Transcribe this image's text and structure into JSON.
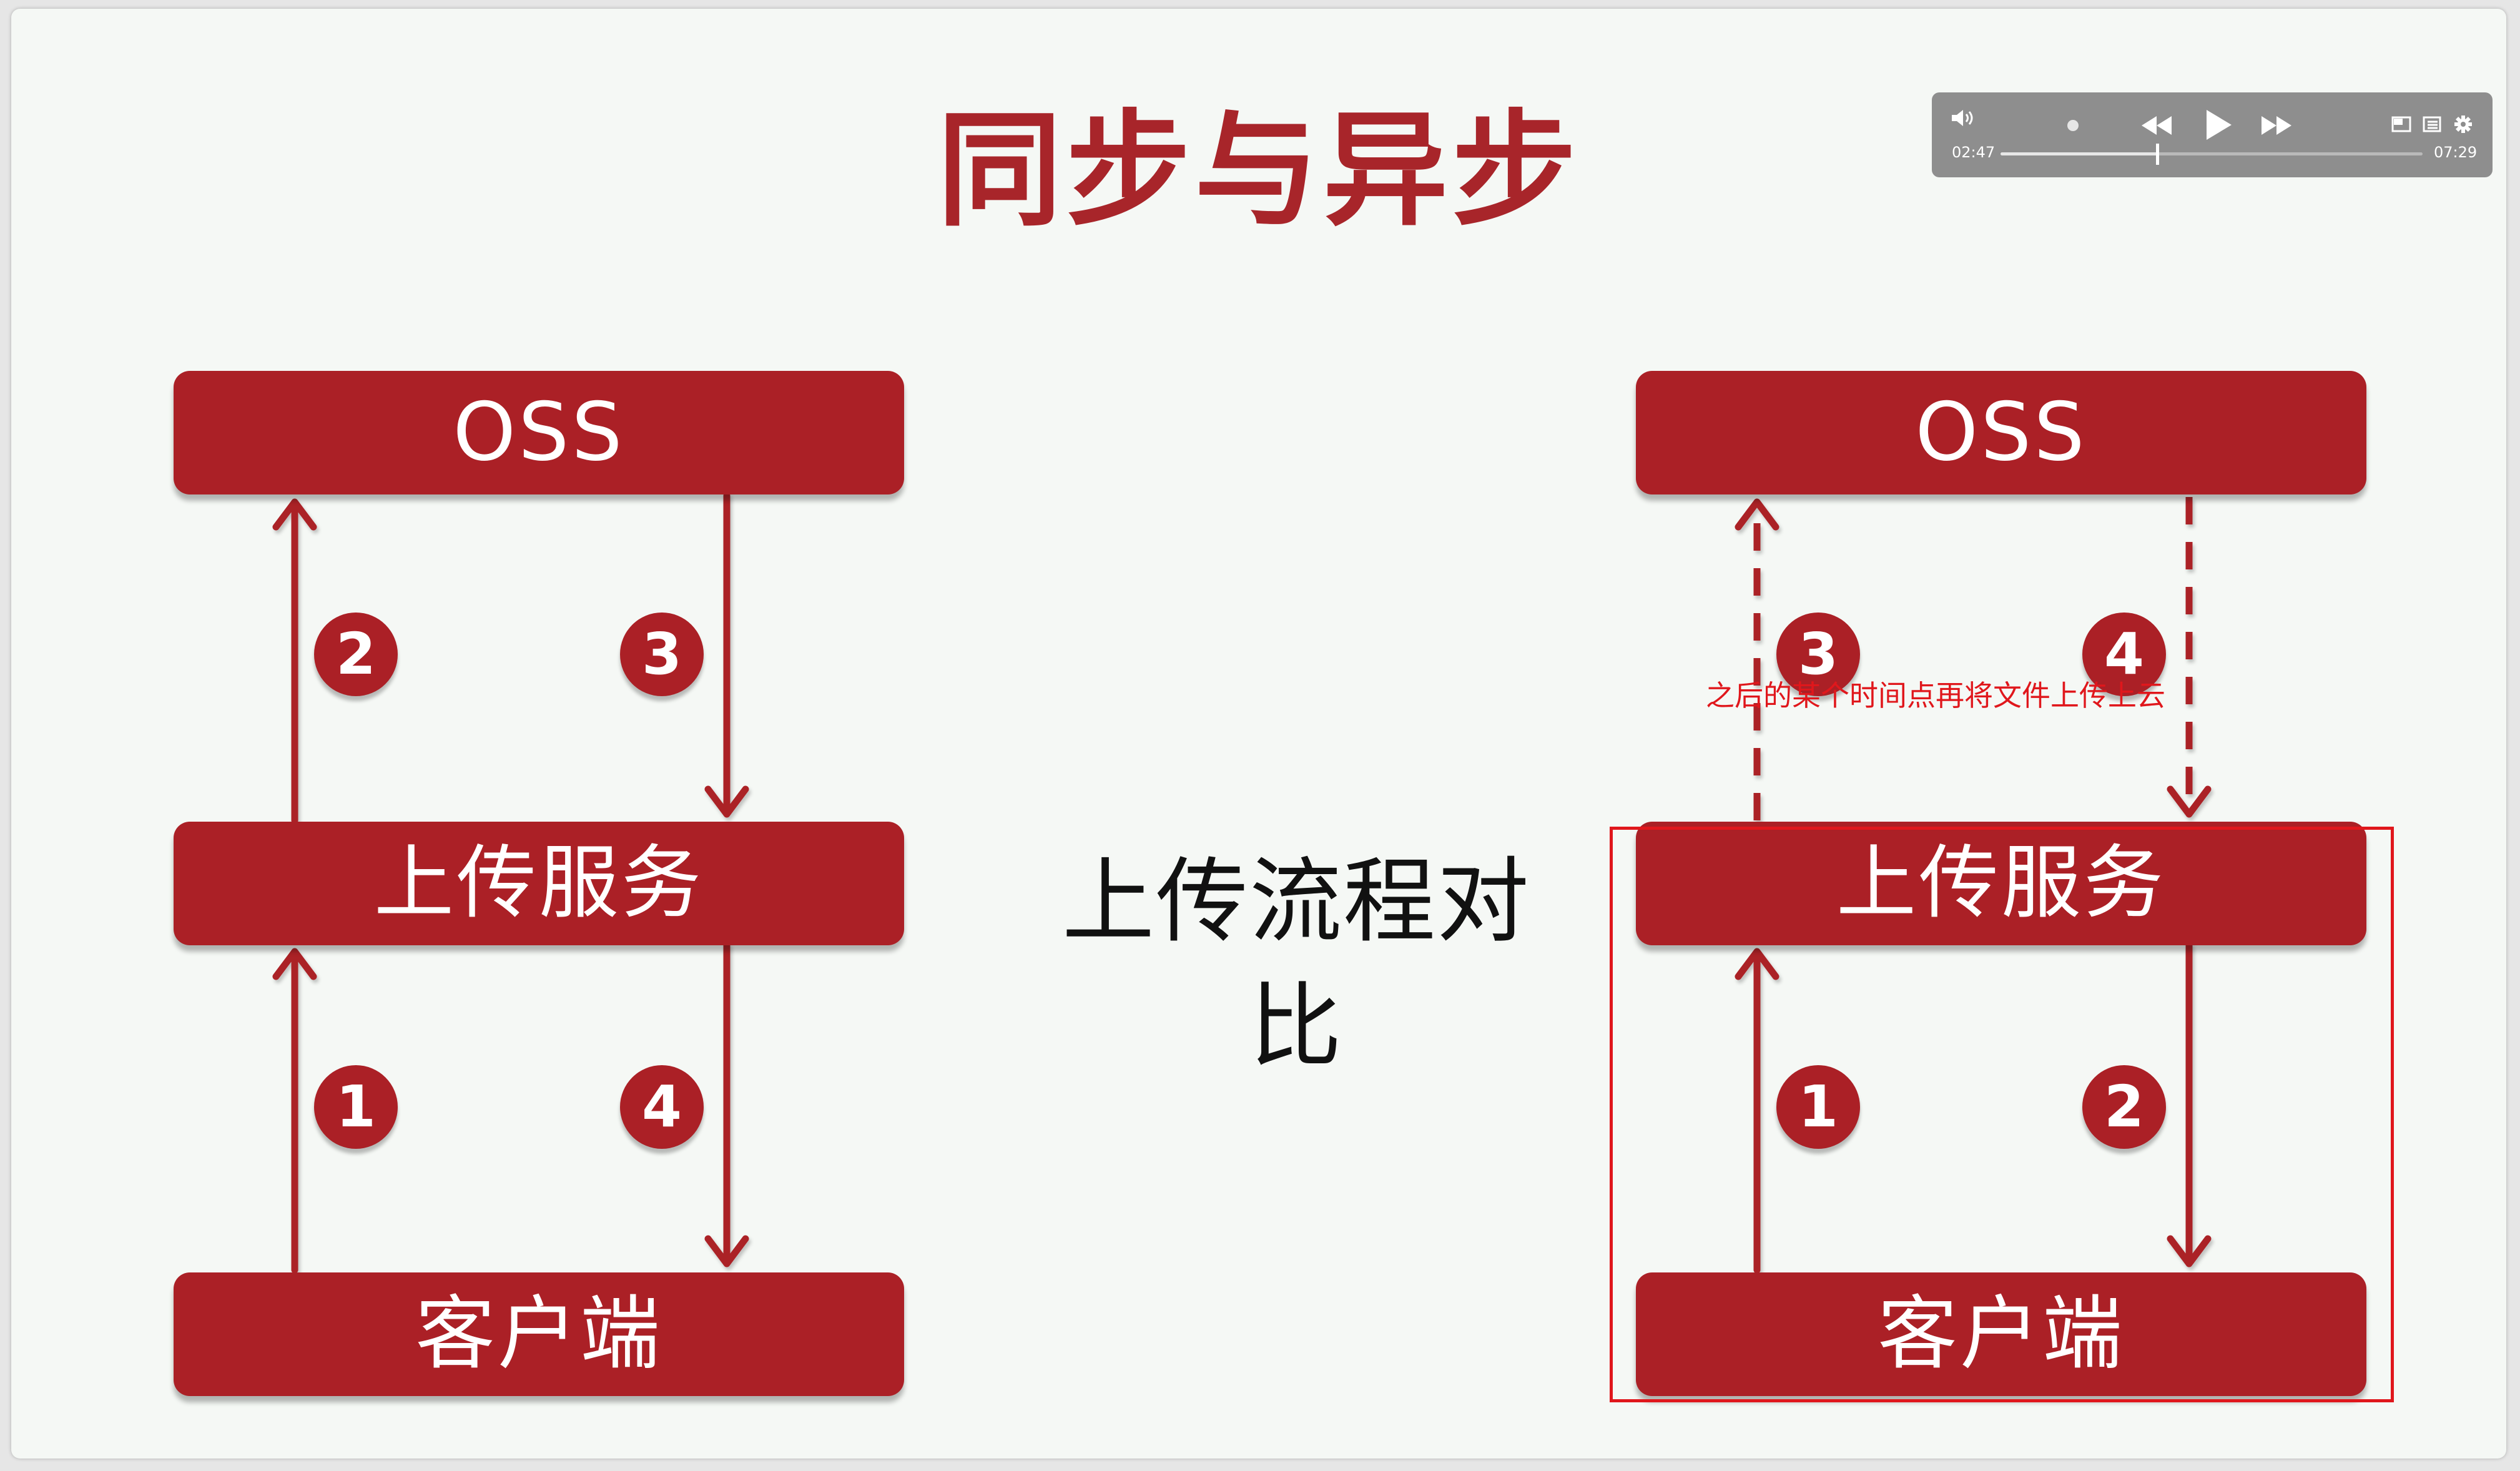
{
  "title": "同步与异步",
  "center_label": "上传流程对比",
  "annotation": "之后的某个时间点再将文件上传上云",
  "left_diagram": {
    "oss_label": "OSS",
    "service_label": "上传服务",
    "client_label": "客户端",
    "badges": [
      "2",
      "3",
      "1",
      "4"
    ]
  },
  "right_diagram": {
    "oss_label": "OSS",
    "service_label": "上传服务",
    "client_label": "客户端",
    "badges": [
      "3",
      "4",
      "1",
      "2"
    ]
  },
  "player": {
    "current_time": "02:47",
    "total_time": "07:29",
    "progress": 0.372,
    "icons": [
      "volume-icon",
      "rewind-icon",
      "play-icon",
      "fast-forward-icon",
      "pip-icon",
      "playlist-icon",
      "gear-icon"
    ]
  },
  "colors": {
    "accent": "#ab2026",
    "annotation": "#e0171c",
    "background": "#f5f8f5"
  }
}
